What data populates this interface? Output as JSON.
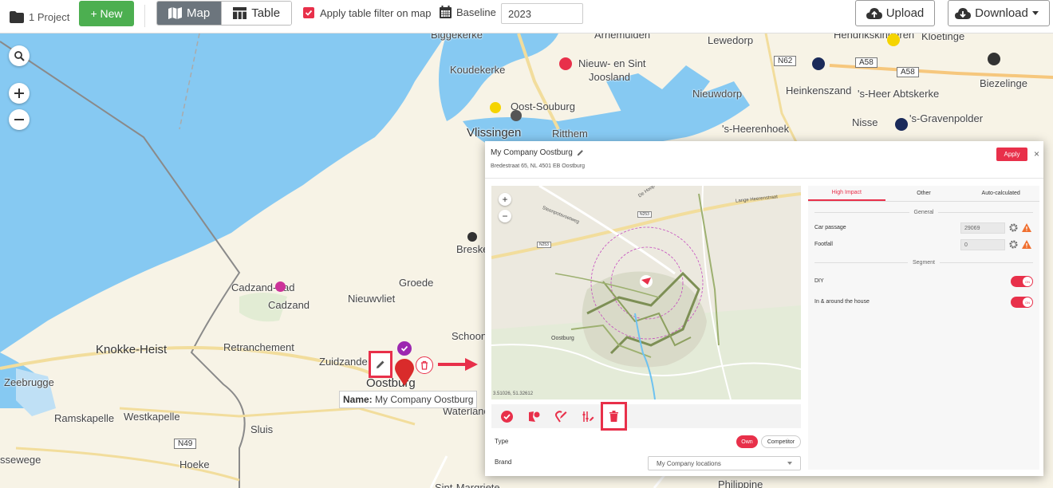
{
  "toolbar": {
    "project_label": "1 Project",
    "new_label": "+ New",
    "map_label": "Map",
    "table_label": "Table",
    "filter_label": "Apply table filter on map",
    "baseline_label": "Baseline",
    "baseline_year": "2023",
    "upload_label": "Upload",
    "download_label": "Download"
  },
  "map": {
    "places": {
      "biggekerke": "Biggekerke",
      "arnemuiden": "Arnemuiden",
      "lewedorp": "Lewedorp",
      "hendrikskinderen": "Hendrikskinderen",
      "kloetinge": "Kloetinge",
      "koudekerke": "Koudekerke",
      "nieuwensint": "Nieuw- en Sint",
      "joosland": "Joosland",
      "heinkenszand": "Heinkenszand",
      "heerabtskerke": "'s-Heer Abtskerke",
      "biezelinge": "Biezelinge",
      "oostsouburg": "Oost-Souburg",
      "nieuwdorp": "Nieuwdorp",
      "vlissingen": "Vlissingen",
      "ritthem": "Ritthem",
      "heerenhoek": "'s-Heerenhoek",
      "nisse": "Nisse",
      "gravenpolder": "'s-Gravenpolder",
      "breskens": "Breskens",
      "cadzandbad": "Cadzand-Bad",
      "cadzand": "Cadzand",
      "groede": "Groede",
      "nieuwvliet": "Nieuwvliet",
      "knokkeheist": "Knokke-Heist",
      "retranchement": "Retranchement",
      "schoondijke": "Schoon",
      "zuidzande": "Zuidzande",
      "oostburg": "Oostburg",
      "zeebrugge": "Zeebrugge",
      "ramskapelle": "Ramskapelle",
      "westkapelle": "Westkapelle",
      "waterland": "Waterland",
      "sluis": "Sluis",
      "hoeke": "Hoeke",
      "sssewege": "ssewege",
      "sintmargriete": "Sint-Margriete",
      "philippine": "Philippine"
    },
    "roads": {
      "n62": "N62",
      "a58a": "A58",
      "a58b": "A58",
      "n49": "N49"
    },
    "tooltip_key": "Name:",
    "tooltip_value": "My Company Oostburg"
  },
  "panel": {
    "title": "My Company Oostburg",
    "address": "Bredestraat 65, NL 4501 EB Oostburg",
    "apply_label": "Apply",
    "close_label": "×",
    "minimap": {
      "labels": {
        "oostburg": "Oostburg",
        "roads1": "Steenpotsvoetweg",
        "roads2": "Lange Heerenstraat",
        "roads3": "De Hoop"
      },
      "road_n253a": "N253",
      "road_n253b": "N253",
      "coords": "3.51026, 51.32612"
    },
    "type_label": "Type",
    "own_label": "Own",
    "competitor_label": "Competitor",
    "brand_label": "Brand",
    "brand_value": "My Company locations",
    "tabs": [
      "High Impact",
      "Other",
      "Auto-calculated"
    ],
    "general_label": "General",
    "car_passage_label": "Car passage",
    "car_passage_value": "29069",
    "footfall_label": "Footfall",
    "footfall_value": "0",
    "segment_label": "Segment",
    "diy_label": "DIY",
    "house_label": "In & around the house",
    "toggle_on": "ON"
  }
}
